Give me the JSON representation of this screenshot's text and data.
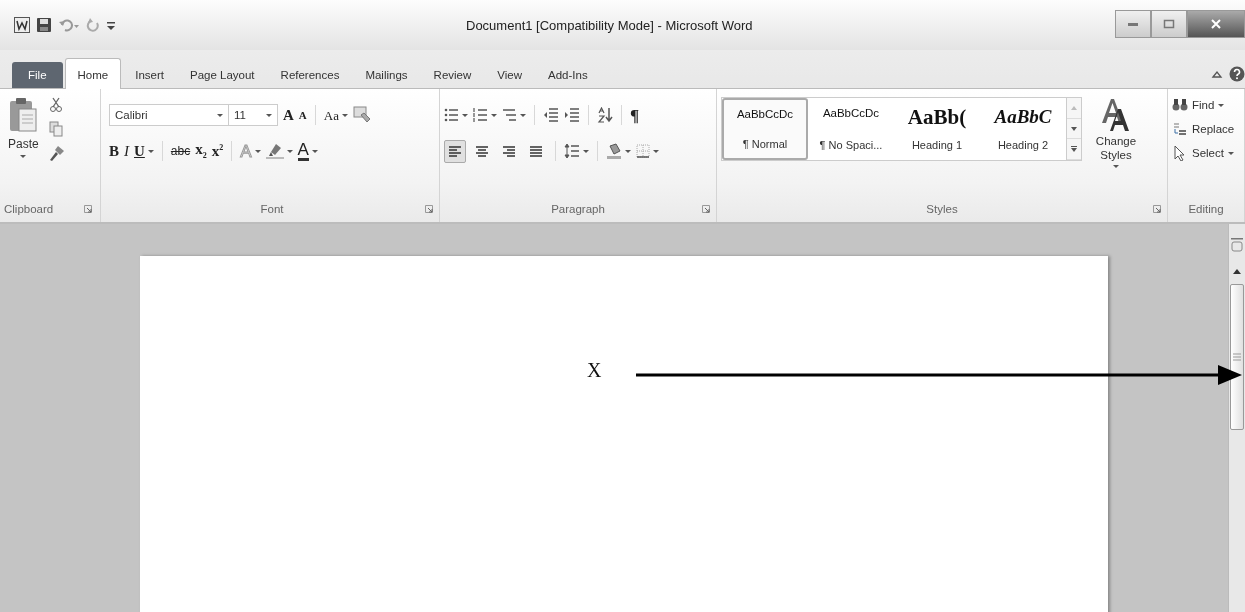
{
  "window": {
    "title": "Document1 [Compatibility Mode] - Microsoft Word"
  },
  "tabs": [
    {
      "label": "File",
      "kind": "file",
      "selected": false
    },
    {
      "label": "Home",
      "kind": "tab",
      "selected": true
    },
    {
      "label": "Insert",
      "kind": "tab",
      "selected": false
    },
    {
      "label": "Page Layout",
      "kind": "tab",
      "selected": false
    },
    {
      "label": "References",
      "kind": "tab",
      "selected": false
    },
    {
      "label": "Mailings",
      "kind": "tab",
      "selected": false
    },
    {
      "label": "Review",
      "kind": "tab",
      "selected": false
    },
    {
      "label": "View",
      "kind": "tab",
      "selected": false
    },
    {
      "label": "Add-Ins",
      "kind": "tab",
      "selected": false
    }
  ],
  "clipboard": {
    "label": "Clipboard",
    "launcher": true,
    "paste_label": "Paste"
  },
  "font": {
    "label": "Font",
    "launcher": true,
    "font_name": "Calibri",
    "font_size": "11",
    "row1_buttons": [
      {
        "text": "A",
        "kind": "grow"
      },
      {
        "text": "A",
        "kind": "shrink"
      },
      {
        "text": "Aa",
        "kind": "case"
      }
    ],
    "row2_buttons": [
      {
        "text": "B",
        "kind": "bold"
      },
      {
        "text": "I",
        "kind": "italic"
      },
      {
        "text": "U",
        "kind": "underline"
      },
      {
        "text": "abc",
        "kind": "strike"
      },
      {
        "text": "x$_{2}$",
        "kind": "sub"
      },
      {
        "text": "x$^{2}$",
        "kind": "sup"
      },
      {
        "text": "A",
        "kind": "effects"
      },
      {
        "kind": "highlight"
      },
      {
        "text": "A",
        "kind": "color"
      }
    ]
  },
  "paragraph": {
    "label": "Paragraph",
    "launcher": true,
    "pilcrow": "¶",
    "alignment": [
      {
        "kind": "left",
        "selected": true
      },
      {
        "kind": "center",
        "selected": false
      },
      {
        "kind": "right",
        "selected": false
      },
      {
        "kind": "justify",
        "selected": false
      }
    ]
  },
  "styles": {
    "label": "Styles",
    "launcher": true,
    "items": [
      {
        "sample": "AaBbCcDc",
        "name": "¶ Normal",
        "kind": "normal",
        "selected": true
      },
      {
        "sample": "AaBbCcDc",
        "name": "¶ No Spaci...",
        "kind": "nospacing",
        "selected": false
      },
      {
        "sample": "AaBb(",
        "name": "Heading 1",
        "kind": "heading1",
        "selected": false
      },
      {
        "sample": "AaBbC",
        "name": "Heading 2",
        "kind": "heading2",
        "selected": false
      }
    ],
    "change_styles": "Change Styles"
  },
  "editing": {
    "label": "Editing",
    "launcher": false,
    "buttons": [
      {
        "label": "Find",
        "kind": "find"
      },
      {
        "label": "Replace",
        "kind": "replace"
      },
      {
        "label": "Select",
        "kind": "select"
      }
    ]
  },
  "document": {
    "mark": "X"
  }
}
